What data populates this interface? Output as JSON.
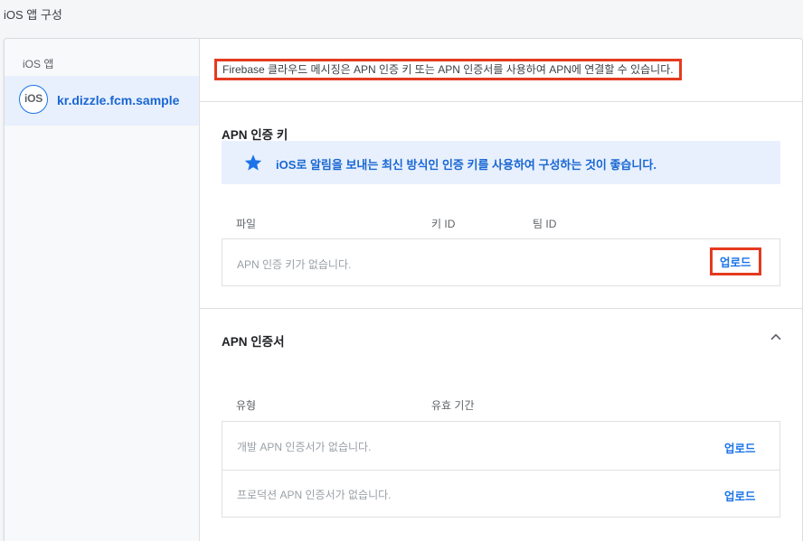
{
  "page": {
    "title": "iOS 앱 구성"
  },
  "sidebar": {
    "heading": "iOS 앱",
    "apps": [
      {
        "badge": "iOS",
        "name": "kr.dizzle.fcm.sample"
      }
    ]
  },
  "banner": {
    "text": "Firebase 클라우드 메시징은 APN 인증 키 또는 APN 인증서를 사용하여 APN에 연결할 수 있습니다."
  },
  "apn_key": {
    "title": "APN 인증 키",
    "info": {
      "icon": "star-icon",
      "text": "iOS로 알림을 보내는 최신 방식인 인증 키를 사용하여 구성하는 것이 좋습니다."
    },
    "columns": [
      "파일",
      "키 ID",
      "팀 ID"
    ],
    "empty_text": "APN 인증 키가 없습니다.",
    "upload_label": "업로드"
  },
  "apn_cert": {
    "title": "APN 인증서",
    "collapse_icon": "chevron-up-icon",
    "columns": [
      "유형",
      "유효 기간"
    ],
    "rows": [
      {
        "empty_text": "개발 APN 인증서가 없습니다.",
        "upload_label": "업로드"
      },
      {
        "empty_text": "프로덕션 APN 인증서가 없습니다.",
        "upload_label": "업로드"
      }
    ]
  },
  "colors": {
    "accent": "#1a73e8",
    "highlight": "#e53a20",
    "info_bg": "#e8f0fe"
  }
}
